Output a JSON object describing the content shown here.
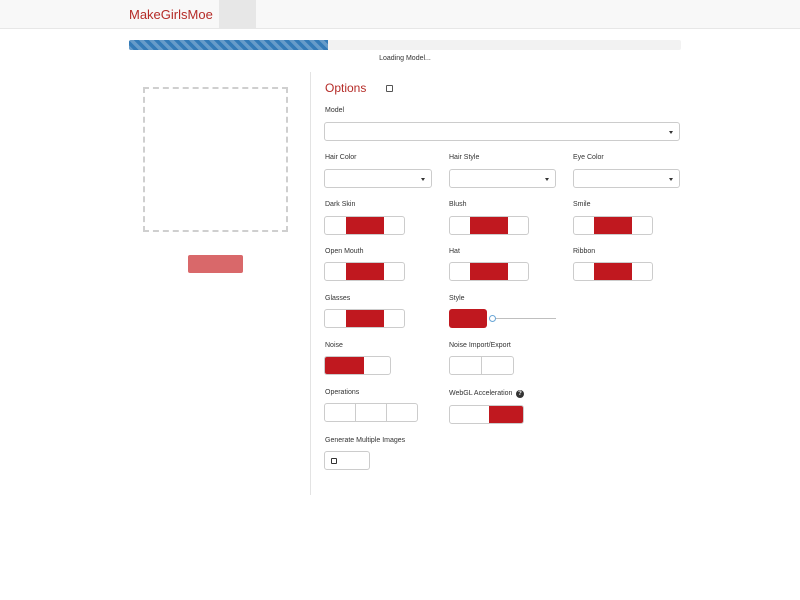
{
  "navbar": {
    "brand": "MakeGirlsMoe"
  },
  "progress": {
    "percent": 36,
    "label": "Loading Model..."
  },
  "options": {
    "title": "Options",
    "labels": {
      "model": "Model",
      "hair_color": "Hair Color",
      "hair_style": "Hair Style",
      "eye_color": "Eye Color",
      "dark_skin": "Dark Skin",
      "blush": "Blush",
      "smile": "Smile",
      "open_mouth": "Open Mouth",
      "hat": "Hat",
      "ribbon": "Ribbon",
      "glasses": "Glasses",
      "style": "Style",
      "noise": "Noise",
      "noise_import_export": "Noise Import/Export",
      "operations": "Operations",
      "webgl_acceleration": "WebGL Acceleration",
      "generate_multiple": "Generate Multiple Images"
    },
    "selects": {
      "model": "",
      "hair_color": "",
      "hair_style": "",
      "eye_color": ""
    }
  },
  "colors": {
    "brand": "#b52b27",
    "accent": "#c0181f",
    "progress": "#337ab7"
  },
  "icons": [
    "chevron-down-icon",
    "question-circle-icon",
    "checkbox-icon"
  ]
}
